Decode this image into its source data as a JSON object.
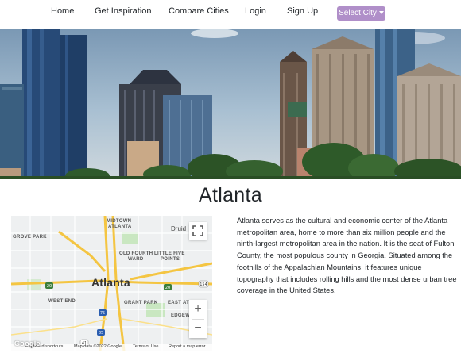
{
  "nav": {
    "home": "Home",
    "inspiration": "Get Inspiration",
    "compare": "Compare Cities",
    "login": "Login",
    "signup": "Sign Up",
    "select_city": "Select City"
  },
  "city": {
    "name": "Atlanta",
    "description": "Atlanta serves as the cultural and economic center of the Atlanta metropolitan area, home to more than six million people and the ninth-largest metropolitan area in the nation. It is the seat of Fulton County, the most populous county in Georgia. Situated among the foothills of the Appalachian Mountains, it features unique topography that includes rolling hills and the most dense urban tree coverage in the United States."
  },
  "map": {
    "city_label": "Atlanta",
    "neighborhoods": {
      "midtown_1": "MIDTOWN",
      "midtown_2": "ATLANTA",
      "grove_park": "GROVE PARK",
      "old_fourth_1": "OLD FOURTH",
      "old_fourth_2": "WARD",
      "little_five_1": "LITTLE FIVE",
      "little_five_2": "POINTS",
      "west_end": "WEST END",
      "grant_park": "GRANT PARK",
      "east_atl": "EAST AT",
      "edgewood": "EDGEWOOD"
    },
    "druid": "Druid",
    "highways": [
      "20",
      "75",
      "20",
      "154",
      "85",
      "41"
    ],
    "zoom_in": "+",
    "zoom_out": "−",
    "google": "Google",
    "attribution": {
      "shortcuts": "Keyboard shortcuts",
      "data": "Map data ©2022 Google",
      "terms": "Terms of Use",
      "report": "Report a map error"
    }
  },
  "colors": {
    "select_button": "#b08fc9",
    "text": "#212529",
    "highway": "#f4c542"
  },
  "icons": {
    "fullscreen": "fullscreen-icon",
    "caret": "caret-down-icon"
  }
}
